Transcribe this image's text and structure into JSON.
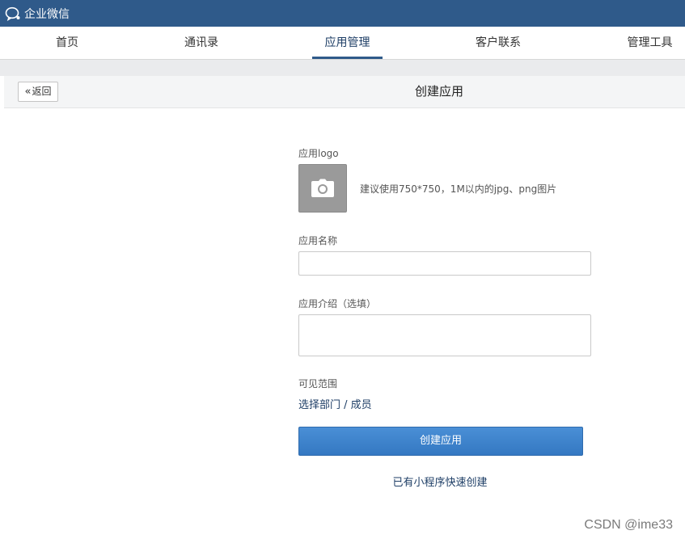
{
  "topbar": {
    "title": "企业微信"
  },
  "nav": {
    "items": [
      {
        "label": "首页"
      },
      {
        "label": "通讯录"
      },
      {
        "label": "应用管理"
      },
      {
        "label": "客户联系"
      },
      {
        "label": "管理工具"
      }
    ],
    "active_index": 2
  },
  "subheader": {
    "back_label": "返回",
    "title": "创建应用"
  },
  "form": {
    "logo_label": "应用logo",
    "logo_hint": "建议使用750*750，1M以内的jpg、png图片",
    "name_label": "应用名称",
    "name_value": "",
    "desc_label": "应用介绍（选填）",
    "desc_value": "",
    "scope_label": "可见范围",
    "scope_link": "选择部门 / 成员",
    "create_button": "创建应用",
    "mini_program_link": "已有小程序快速创建"
  },
  "watermark": "CSDN @ime33",
  "colors": {
    "topbar": "#2f5a8a",
    "primary_button": "#3b82cc",
    "link": "#1e3e66"
  }
}
